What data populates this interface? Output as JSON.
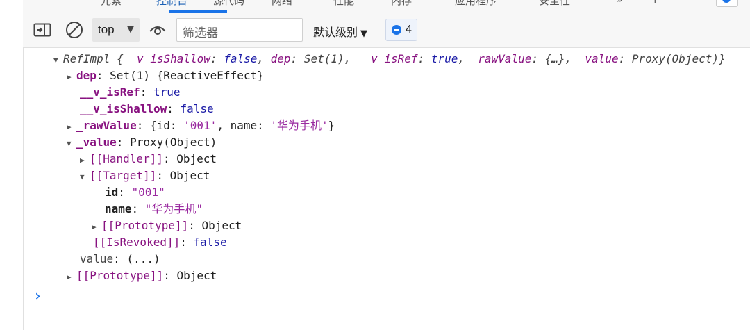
{
  "tabs": [
    "元素",
    "控制台",
    "源代码",
    "网络",
    "性能",
    "内存",
    "应用程序",
    "安全性",
    "»",
    "+"
  ],
  "toolbar": {
    "context": "top",
    "filter_placeholder": "筛选器",
    "levels": "默认级别",
    "issues_count": "4"
  },
  "console": {
    "lines": [
      {
        "head": "RefImpl",
        "rest_parts": [
          {
            "t": " {",
            "c": "gr"
          },
          {
            "t": "__v_isShallow",
            "c": "k"
          },
          {
            "t": ": ",
            "c": "gr"
          },
          {
            "t": "false",
            "c": "kw"
          },
          {
            "t": ", ",
            "c": "gr"
          },
          {
            "t": "dep",
            "c": "k"
          },
          {
            "t": ": Set(1), ",
            "c": "gr"
          },
          {
            "t": "__v_isRef",
            "c": "k"
          },
          {
            "t": ": ",
            "c": "gr"
          },
          {
            "t": "true",
            "c": "kw"
          },
          {
            "t": ", ",
            "c": "gr"
          },
          {
            "t": "_rawValue",
            "c": "k"
          },
          {
            "t": ": {…}, ",
            "c": "gr"
          },
          {
            "t": "_value",
            "c": "k"
          },
          {
            "t": ": Proxy(Object)}",
            "c": "gr"
          }
        ]
      },
      {
        "key": "dep",
        "val": ": Set(1) {ReactiveEffect}"
      },
      {
        "key": "__v_isRef",
        "val_kw": "true"
      },
      {
        "key": "__v_isShallow",
        "val_kw": "false"
      },
      {
        "key": "_rawValue",
        "val_pre": ": {id: ",
        "val_s1": "'001'",
        "val_mid": ", name: ",
        "val_s2": "'华为手机'",
        "val_post": "}"
      },
      {
        "key": "_value",
        "val": ": Proxy(Object)"
      },
      {
        "key": "[[Handler]]",
        "val": ": Object"
      },
      {
        "key": "[[Target]]",
        "val": ": Object"
      },
      {
        "key": "id",
        "val_str": "\"001\""
      },
      {
        "key": "name",
        "val_str": "\"华为手机\""
      },
      {
        "key": "[[Prototype]]",
        "val": ": Object"
      },
      {
        "key": "[[IsRevoked]]",
        "val_kw": "false"
      },
      {
        "key": "value",
        "val": ": (...)"
      },
      {
        "key": "[[Prototype]]",
        "val": ": Object"
      }
    ]
  },
  "prompt": "›"
}
